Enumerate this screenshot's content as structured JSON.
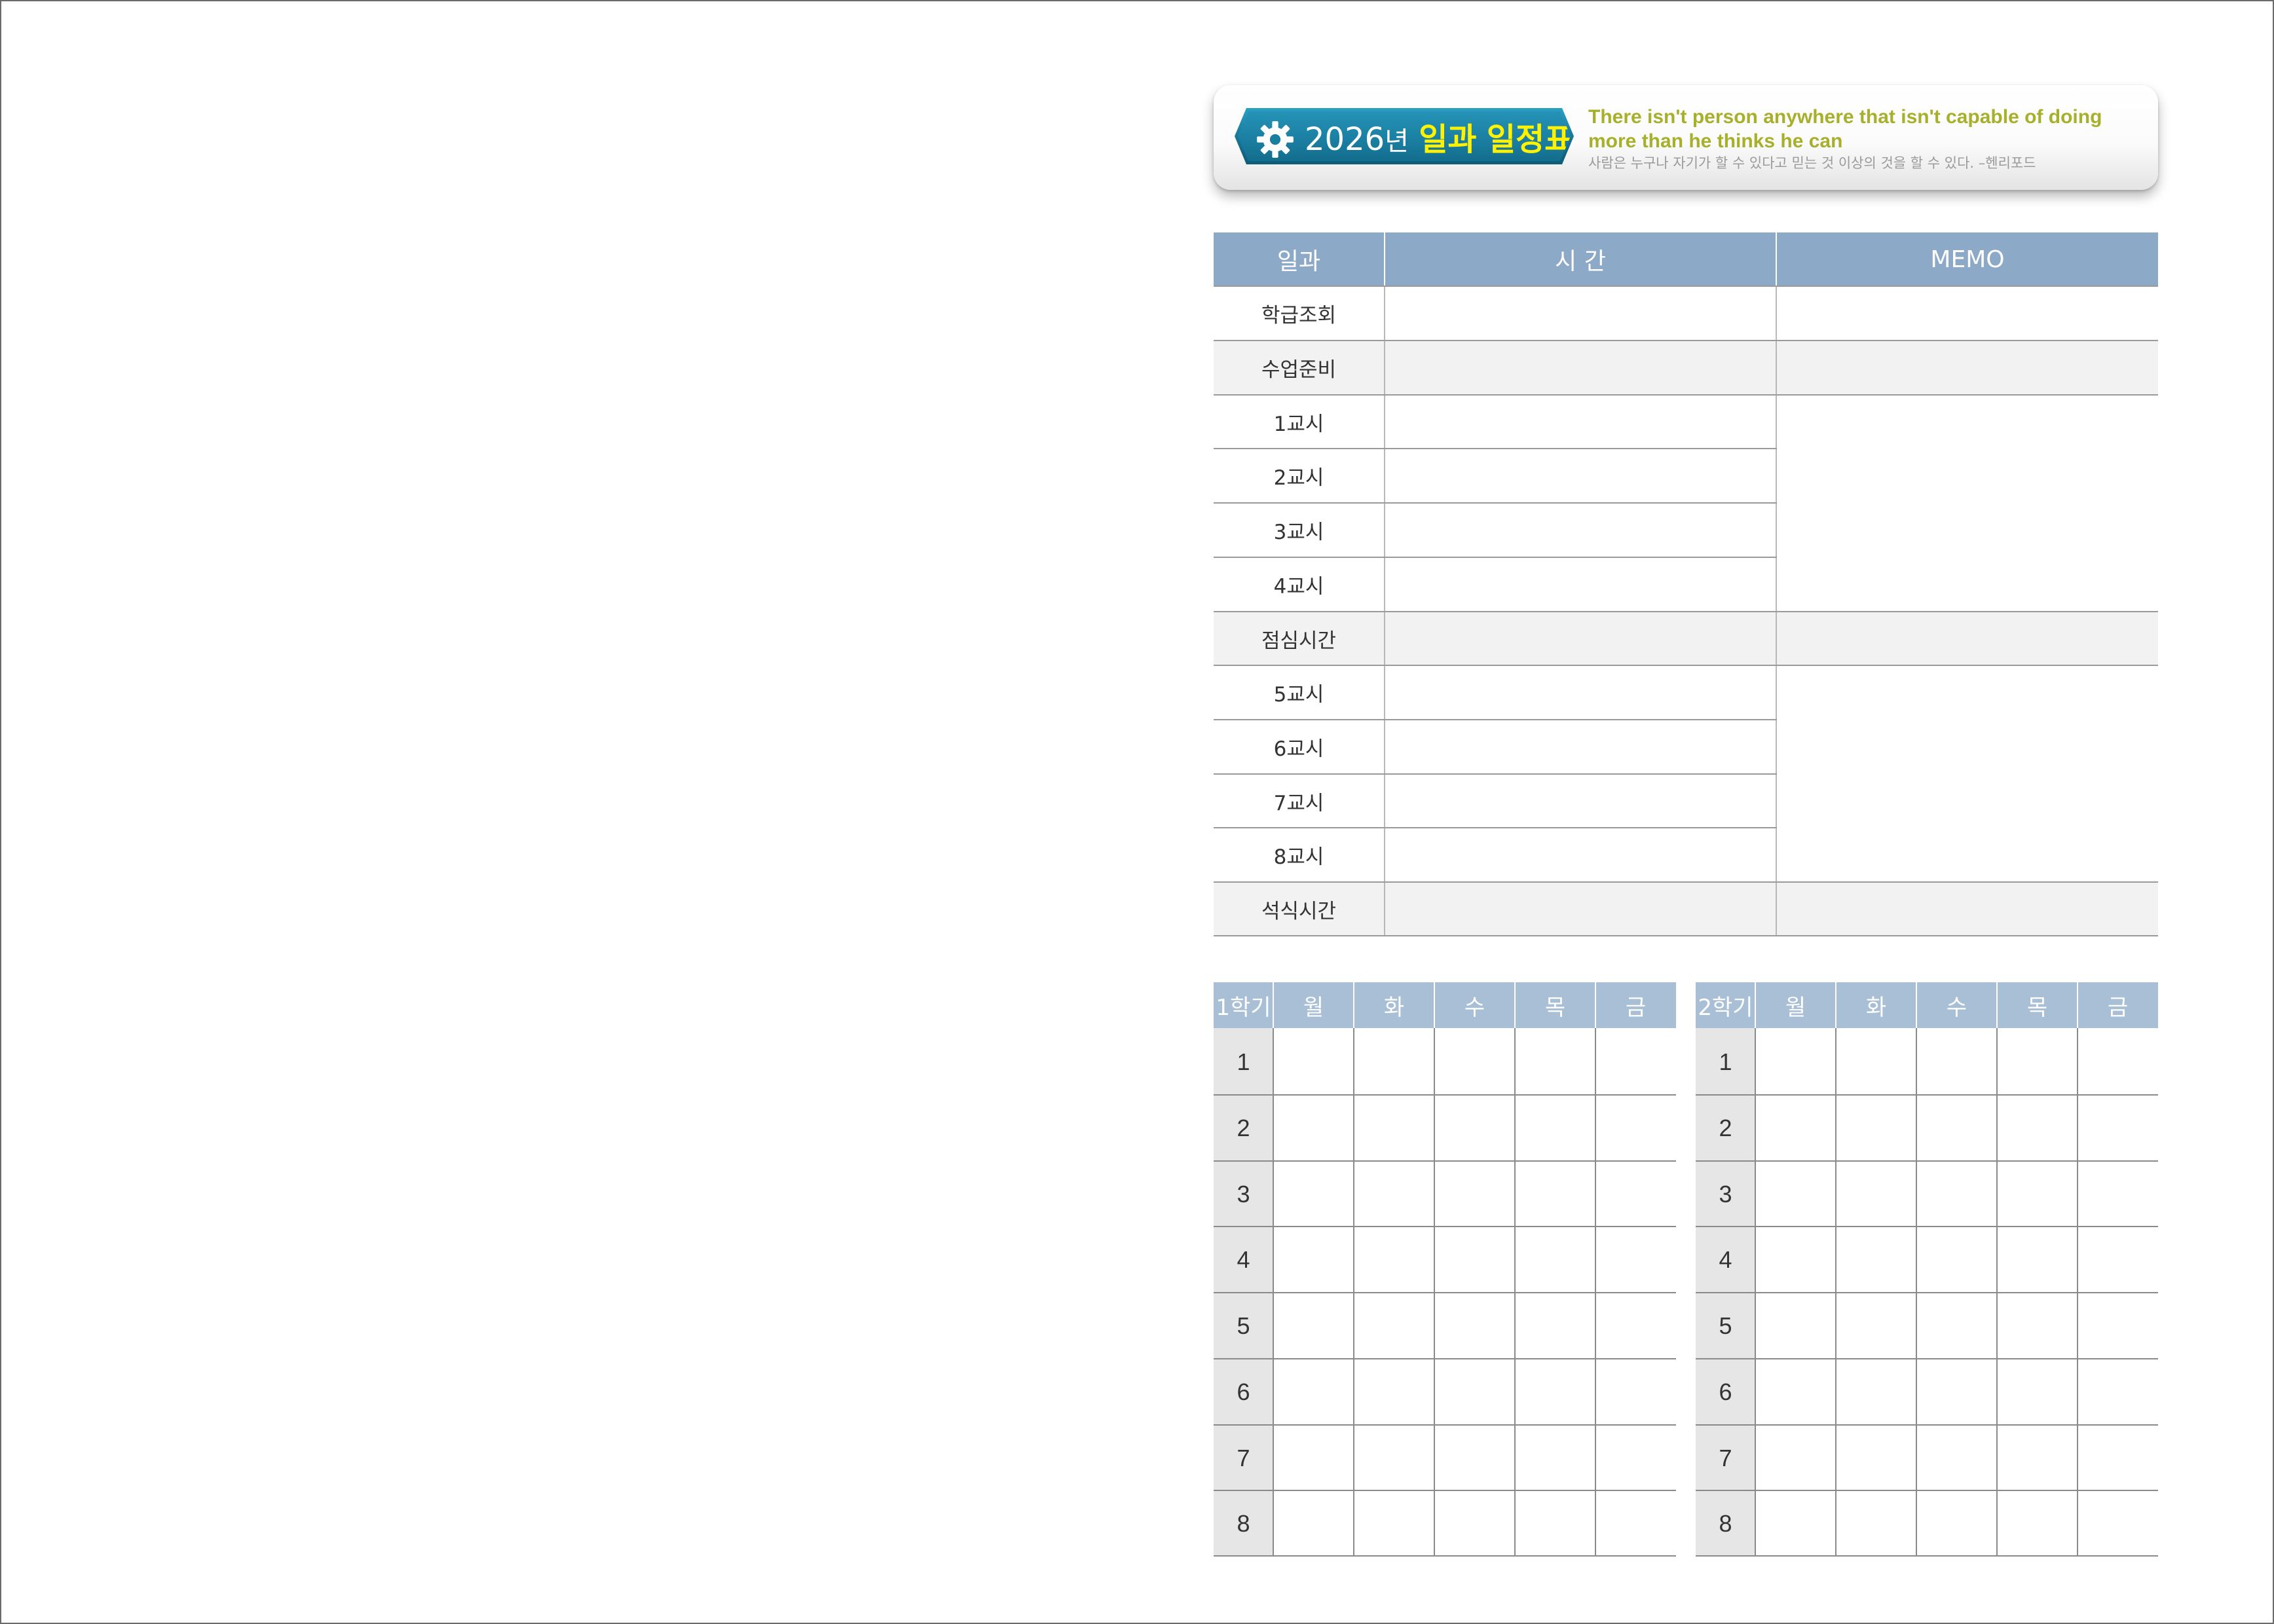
{
  "banner": {
    "year": "2026",
    "year_suffix": "년",
    "title_word1": "일과",
    "title_word2": "일정표",
    "quote_en": "There isn't person anywhere that isn't capable of doing more than he thinks he can",
    "quote_ko": "사람은 누구나 자기가 할 수 있다고 믿는 것 이상의 것을 할 수 있다. –헨리포드",
    "icon": "gear-icon"
  },
  "schedule": {
    "headers": [
      "일과",
      "시 간",
      "MEMO"
    ],
    "rows": [
      "학급조회",
      "수업준비",
      "1교시",
      "2교시",
      "3교시",
      "4교시",
      "점심시간",
      "5교시",
      "6교시",
      "7교시",
      "8교시",
      "석식시간"
    ]
  },
  "semester1": {
    "title": "1학기",
    "days": [
      "월",
      "화",
      "수",
      "목",
      "금"
    ],
    "periods": [
      "1",
      "2",
      "3",
      "4",
      "5",
      "6",
      "7",
      "8"
    ]
  },
  "semester2": {
    "title": "2학기",
    "days": [
      "월",
      "화",
      "수",
      "목",
      "금"
    ],
    "periods": [
      "1",
      "2",
      "3",
      "4",
      "5",
      "6",
      "7",
      "8"
    ]
  },
  "colors": {
    "header_blue": "#8ca9c7",
    "semester_header_blue": "#a9bfd6",
    "badge_teal": "#1a7ea1",
    "quote_green": "#a7b02a",
    "title_yellow": "#fff200",
    "row_gray": "#f2f2f2"
  }
}
